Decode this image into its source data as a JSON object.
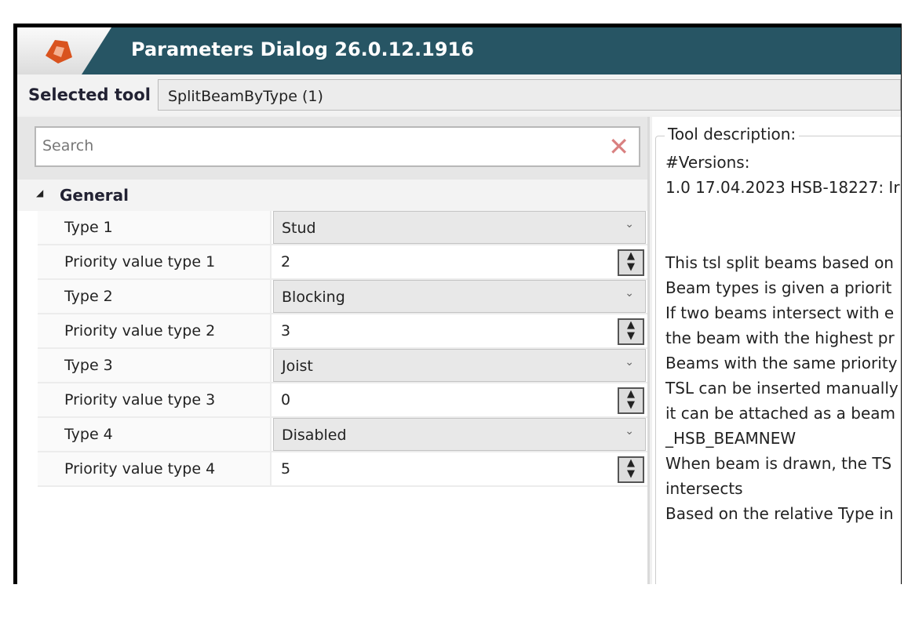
{
  "window": {
    "title": "Parameters Dialog 26.0.12.1916"
  },
  "selected_tool": {
    "label": "Selected tool",
    "value": "SplitBeamByType (1)"
  },
  "search": {
    "placeholder": "Search",
    "clear_icon": "close-icon"
  },
  "group": {
    "title": "General"
  },
  "properties": [
    {
      "name": "Type 1",
      "value": "Stud",
      "kind": "select"
    },
    {
      "name": "Priority value type 1",
      "value": "2",
      "kind": "spin"
    },
    {
      "name": "Type 2",
      "value": "Blocking",
      "kind": "select"
    },
    {
      "name": "Priority value type 2",
      "value": "3",
      "kind": "spin"
    },
    {
      "name": "Type 3",
      "value": "Joist",
      "kind": "select"
    },
    {
      "name": "Priority value type 3",
      "value": "0",
      "kind": "spin"
    },
    {
      "name": "Type 4",
      "value": "Disabled",
      "kind": "select"
    },
    {
      "name": "Priority value type 4",
      "value": "5",
      "kind": "spin"
    }
  ],
  "description": {
    "label": "Tool description:",
    "lines": [
      "#Versions:",
      "1.0 17.04.2023 HSB-18227: Ir",
      "",
      "",
      "This tsl split beams based on",
      "Beam types is given a priorit",
      "If two beams intersect with e",
      "the beam with the highest pr",
      "Beams with the same priority",
      "TSL can be inserted manually",
      "it can be attached as a beam",
      "_HSB_BEAMNEW",
      "When beam is drawn, the TS",
      "intersects",
      "Based on the relative Type in"
    ]
  },
  "colors": {
    "titlebar": "#275564",
    "logo": "#d9531e"
  }
}
